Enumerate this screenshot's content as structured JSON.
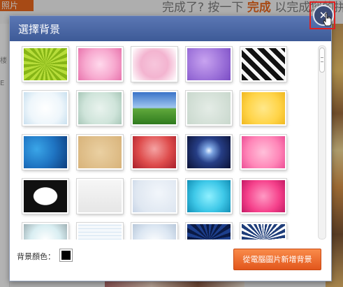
{
  "background_app": {
    "tab_label": "照片",
    "instruction_prefix": "完成了? 按一下",
    "instruction_done": "完成",
    "instruction_suffix": "以完成您的拼",
    "sidebar_chars": [
      "楼",
      "E"
    ]
  },
  "dialog": {
    "title": "選擇背景",
    "close_icon": "close-x-icon",
    "background_color_label": "背景顏色：",
    "background_color": "#000000",
    "add_button_label": "從電腦圖片新增背景"
  },
  "thumbnails": [
    {
      "name": "green-sunburst"
    },
    {
      "name": "pink-gradient"
    },
    {
      "name": "pink-lace"
    },
    {
      "name": "purple-glitter"
    },
    {
      "name": "black-white-stripes"
    },
    {
      "name": "white-frost"
    },
    {
      "name": "mint-vignette"
    },
    {
      "name": "grass-sky"
    },
    {
      "name": "sage-paper"
    },
    {
      "name": "yellow-glow"
    },
    {
      "name": "blue-rays"
    },
    {
      "name": "tan-burlap"
    },
    {
      "name": "red-spotlight"
    },
    {
      "name": "night-heart"
    },
    {
      "name": "pink-stars"
    },
    {
      "name": "zebra-frame"
    },
    {
      "name": "white-paper"
    },
    {
      "name": "blue-white-floral"
    },
    {
      "name": "aqua-glow"
    },
    {
      "name": "hot-pink-glow"
    },
    {
      "name": "grunge-frame"
    },
    {
      "name": "blue-lines"
    },
    {
      "name": "snow-blue"
    },
    {
      "name": "dark-blue-burst"
    },
    {
      "name": "navy-sunburst"
    }
  ]
}
